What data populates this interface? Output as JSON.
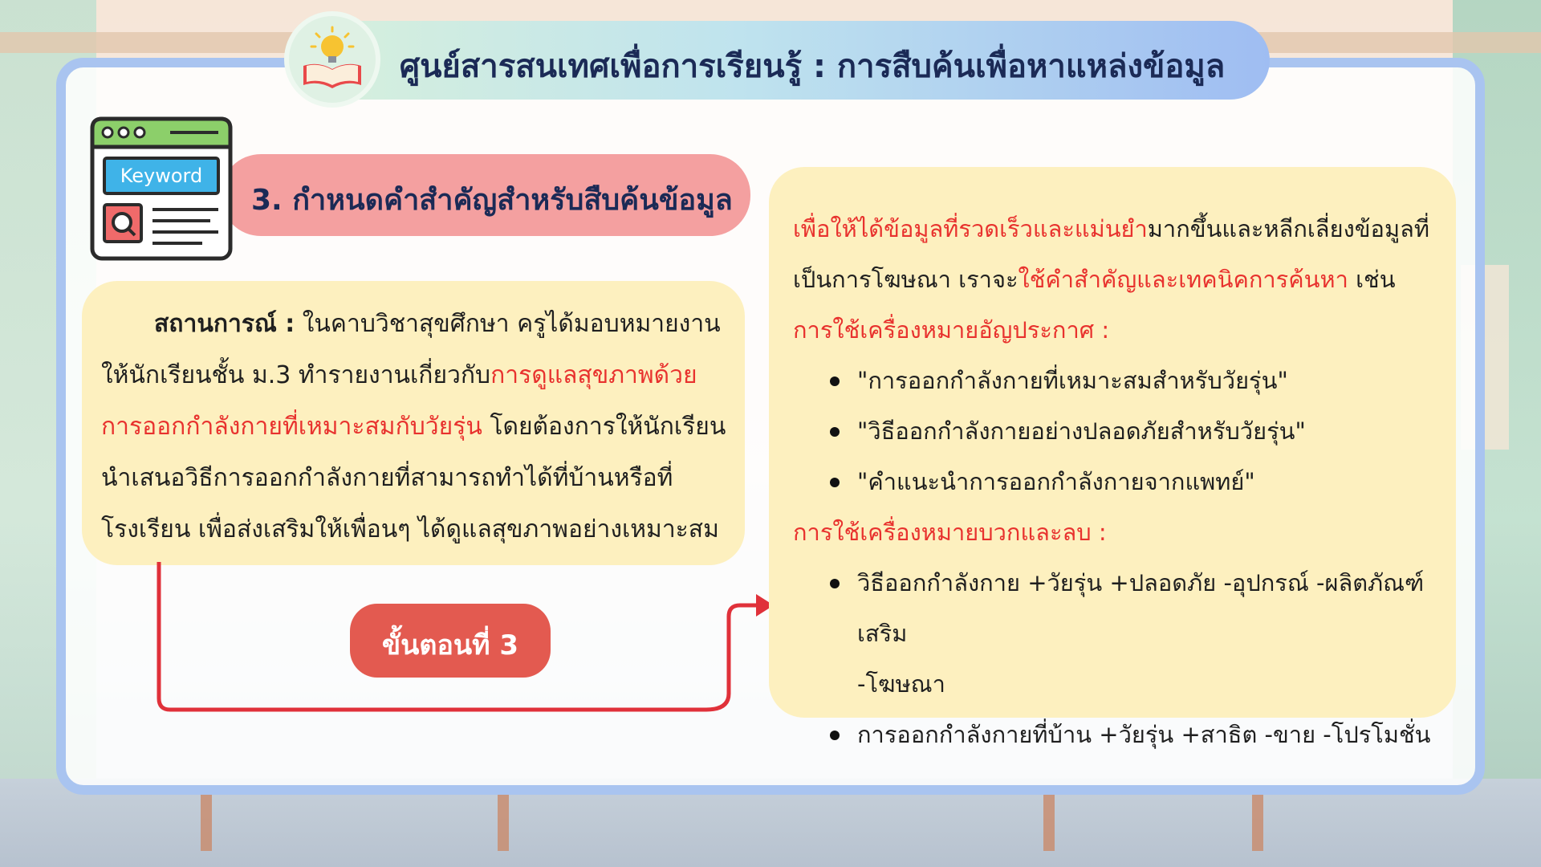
{
  "header": {
    "title": "ศูนย์สารสนเทศเพื่อการเรียนรู้ : การสืบค้นเพื่อหาแหล่งข้อมูล"
  },
  "step_header": {
    "label": "3. กำหนดคำสำคัญสำหรับสืบค้นข้อมูล",
    "icon_text": "Keyword"
  },
  "situation": {
    "label": "สถานการณ์ :",
    "text_1": " ในคาบวิชาสุขศึกษา ครูได้มอบหมายงานให้นักเรียนชั้น ม.3 ทำรายงานเกี่ยวกับ",
    "text_red": "การดูแลสุขภาพด้วยการออกกำลังกายที่เหมาะสมกับวัยรุ่น",
    "text_2": " โดยต้องการให้นักเรียนนำเสนอวิธีการออกกำลังกายที่สามารถทำได้ที่บ้านหรือที่โรงเรียน เพื่อส่งเสริมให้เพื่อนๆ ได้ดูแลสุขภาพอย่างเหมาะสม"
  },
  "step_badge": {
    "label": "ขั้นตอนที่ 3"
  },
  "info": {
    "intro_red_1": "เพื่อให้ได้ข้อมูลที่รวดเร็วและแม่นยำ",
    "intro_1": "มากขึ้นและหลีกเลี่ยงข้อมูลที่เป็นการโฆษณา เราจะ",
    "intro_red_2": "ใช้คำสำคัญและเทคนิคการค้นหา",
    "intro_2": " เช่น",
    "quote_heading": "การใช้เครื่องหมายอัญประกาศ :",
    "quote_items": [
      "\"การออกกำลังกายที่เหมาะสมสำหรับวัยรุ่น\"",
      "\"วิธีออกกำลังกายอย่างปลอดภัยสำหรับวัยรุ่น\"",
      "\"คำแนะนำการออกกำลังกายจากแพทย์\""
    ],
    "plusminus_heading": "การใช้เครื่องหมายบวกและลบ :",
    "plusminus_item_1_line_1": "วิธีออกกำลังกาย +วัยรุ่น +ปลอดภัย -อุปกรณ์ -ผลิตภัณฑ์เสริม",
    "plusminus_item_1_line_2": "-โฆษณา",
    "plusminus_item_2": "การออกกำลังกายที่บ้าน +วัยรุ่น +สาธิต -ขาย -โปรโมชั่น"
  },
  "colors": {
    "accent_red": "#e8322e",
    "card_border": "#a9c4f0",
    "box_fill": "#fdf0bf",
    "step_header_fill": "#f4a0a0",
    "badge_fill": "#e35a50"
  },
  "icons": {
    "title_icon": "open-book-lightbulb-icon",
    "step_icon": "keyword-search-window-icon"
  }
}
